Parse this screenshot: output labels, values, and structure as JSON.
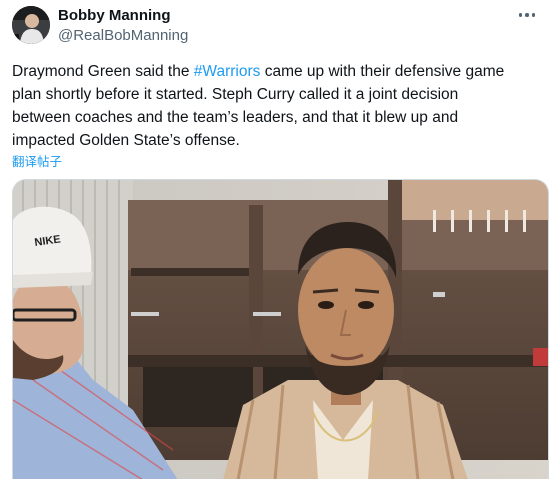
{
  "author": {
    "display_name": "Bobby Manning",
    "handle": "@RealBobManning",
    "avatar_icon": "user-photo"
  },
  "tweet": {
    "text_before": "Draymond Green said the ",
    "hashtag": "#Warriors",
    "text_after": " came up with their defensive game\nplan shortly before it started. Steph Curry called it a joint decision\nbetween coaches and the team’s leaders, and that it blew up and\nimpacted Golden State’s offense.",
    "translate_label": "翻译帖子"
  },
  "media": {
    "cap_brand": "NIKE"
  },
  "colors": {
    "text": "#0f1419",
    "secondary": "#536471",
    "accent": "#1d9bf0",
    "border": "#cfd9de"
  },
  "icons": {
    "more": "more-dots-icon"
  }
}
